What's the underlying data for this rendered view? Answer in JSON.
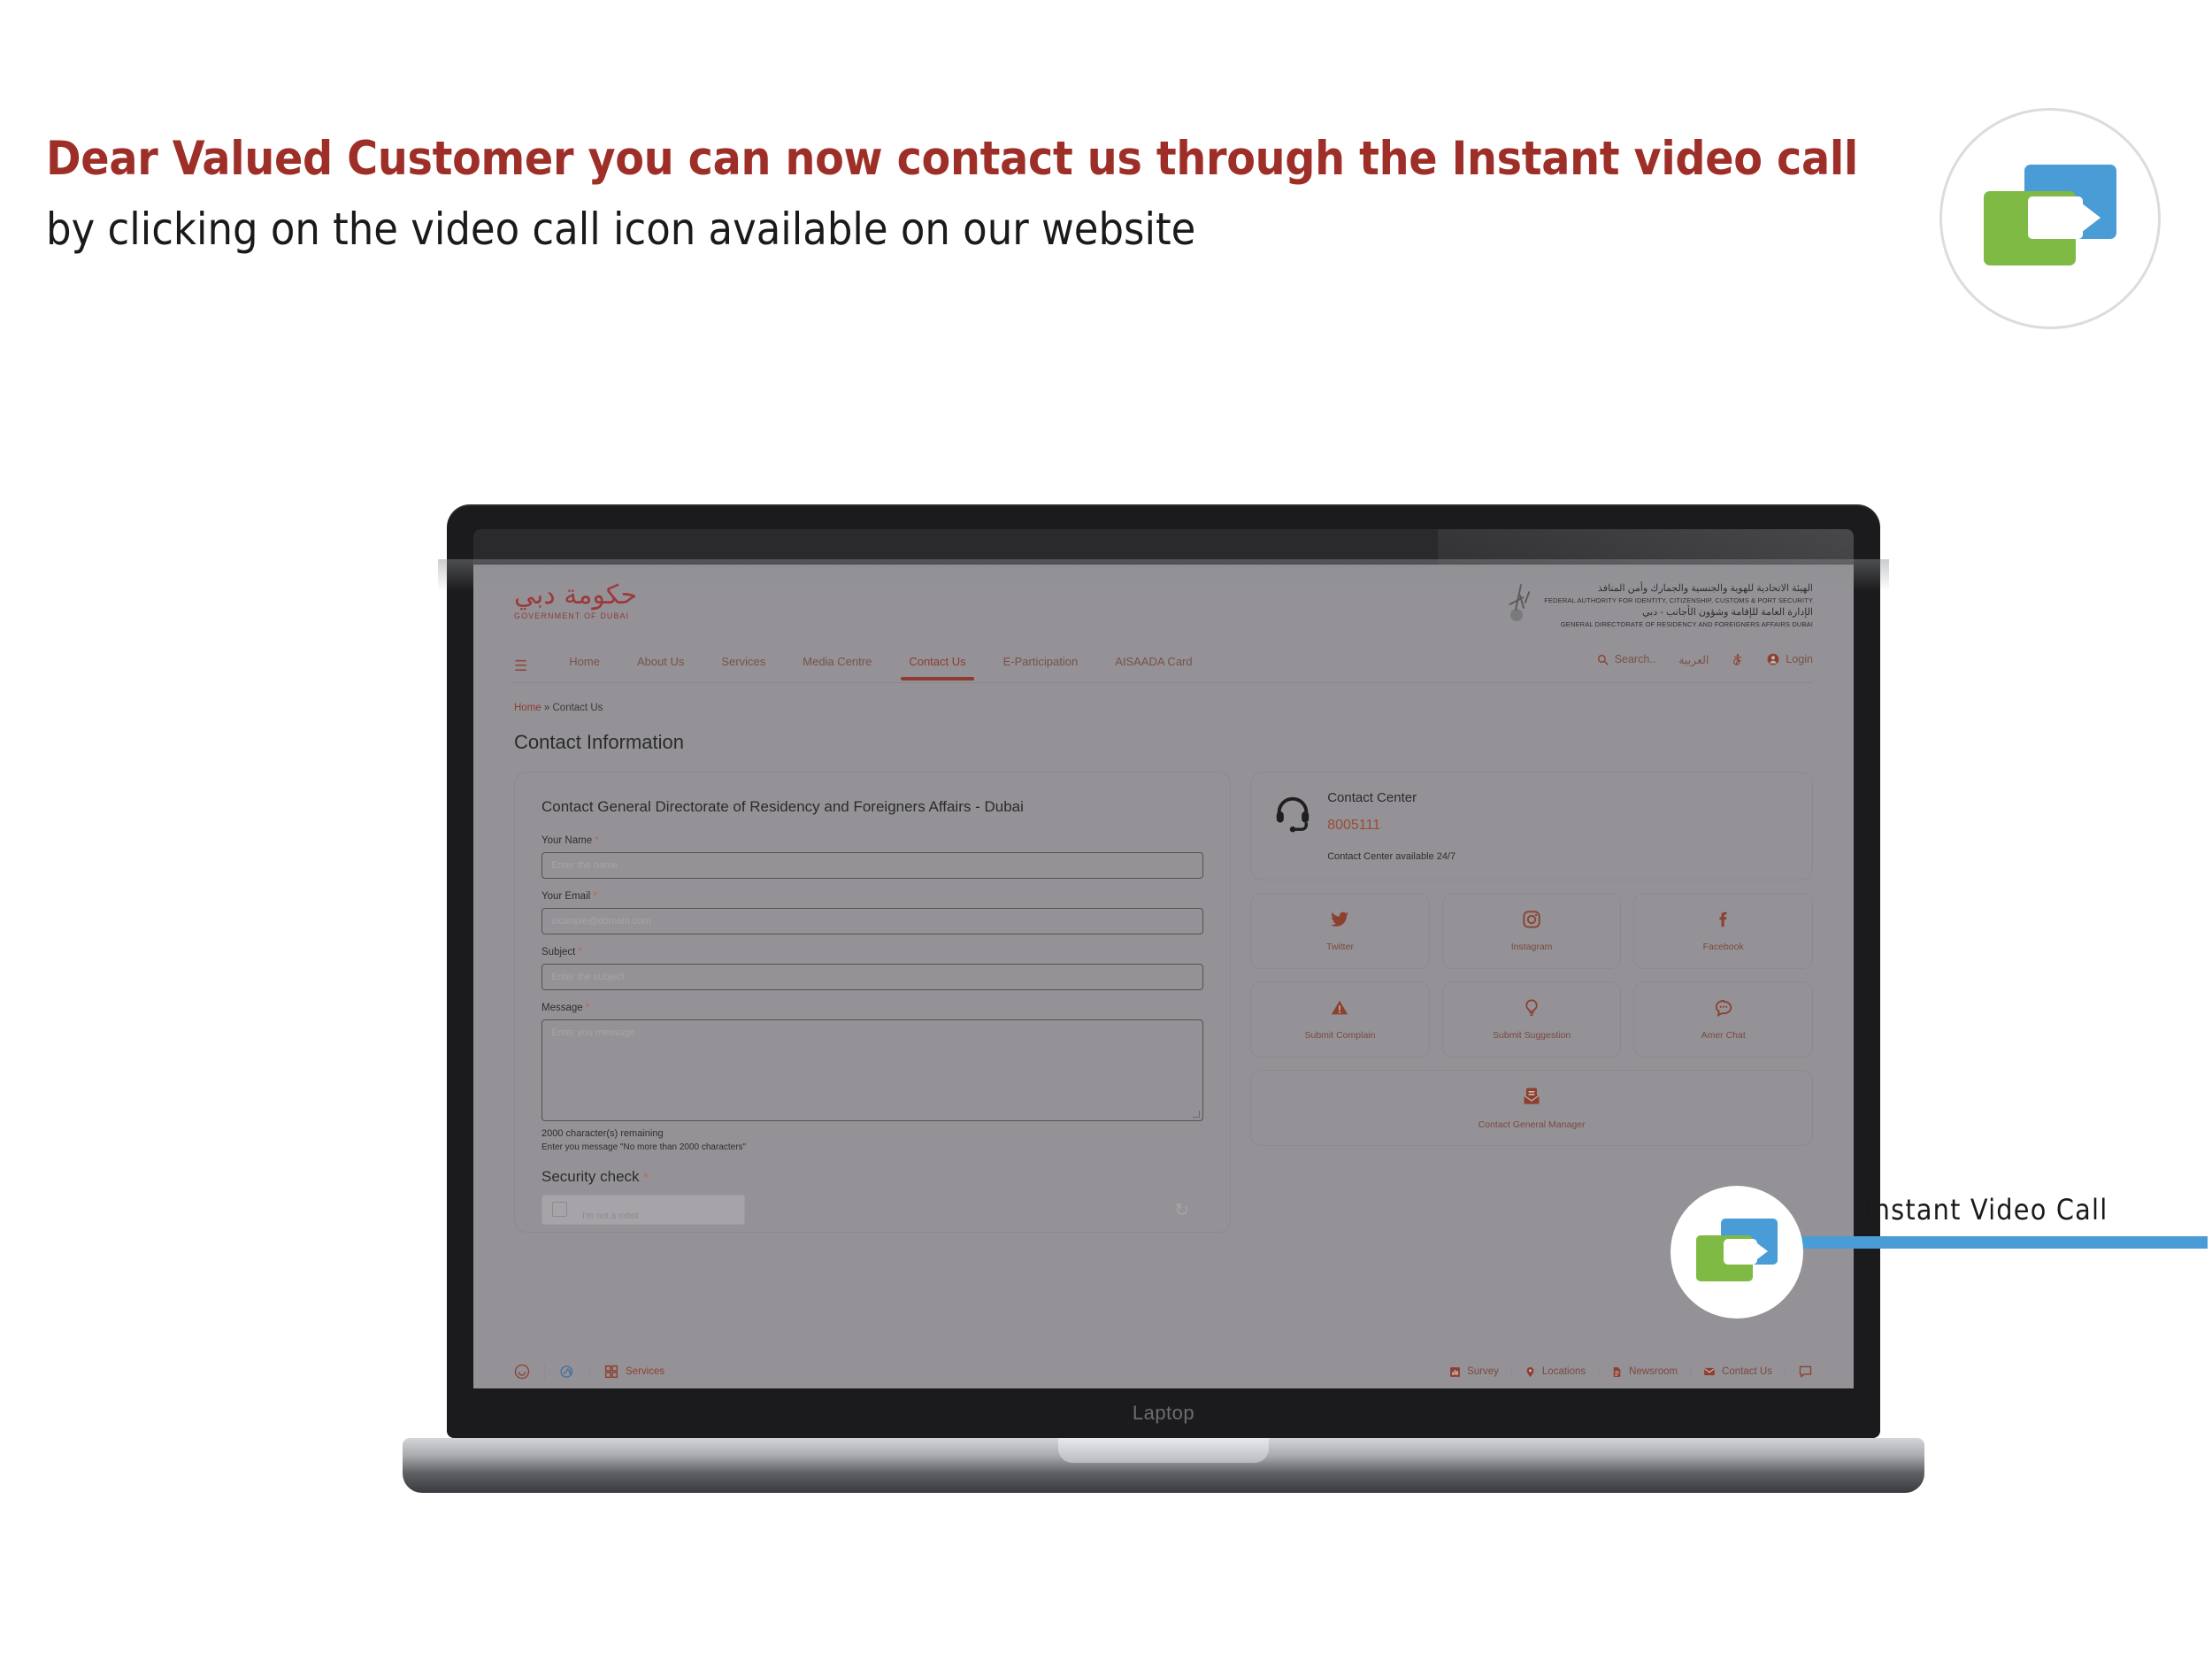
{
  "headline": {
    "line1": "Dear Valued Customer you can now contact us through the Instant video call",
    "line2": "by clicking on the video call icon available on our website",
    "line1_color": "#9e2f28",
    "line2_color": "#1a1a1a"
  },
  "badge": {
    "icon": "video-chat-icon"
  },
  "callout": {
    "label": "Instant Video Call",
    "line_color": "#4a9cd6",
    "icon": "video-chat-icon"
  },
  "device": {
    "label": "Laptop"
  },
  "site": {
    "gov_logo": {
      "arabic": "حكومة دبي",
      "latin": "GOVERNMENT OF DUBAI"
    },
    "federal_logo": {
      "ar_line1": "الهيئة الاتحادية للهوية والجنسية والجمارك وأمن المنافذ",
      "en_line1": "FEDERAL AUTHORITY FOR IDENTITY, CITIZENSHIP, CUSTOMS & PORT SECURITY",
      "ar_line2": "الإدارة العامة للإقامة وشؤون الأجانب - دبي",
      "en_line2": "GENERAL DIRECTORATE OF RESIDENCY AND FOREIGNERS AFFAIRS  DUBAI"
    },
    "nav": {
      "menu_icon": "hamburger-icon",
      "items": [
        {
          "label": "Home",
          "active": false
        },
        {
          "label": "About Us",
          "active": false
        },
        {
          "label": "Services",
          "active": false
        },
        {
          "label": "Media Centre",
          "active": false
        },
        {
          "label": "Contact Us",
          "active": true
        },
        {
          "label": "E-Participation",
          "active": false
        },
        {
          "label": "AISAADA Card",
          "active": false
        }
      ],
      "search_label": "Search..",
      "search_icon": "search-icon",
      "arabic_label": "العربية",
      "accessibility_icon": "accessibility-icon",
      "login_label": "Login",
      "login_icon": "user-circle-icon"
    },
    "breadcrumb": {
      "home": "Home",
      "separator": "»",
      "current": "Contact Us"
    },
    "page_title": "Contact Information",
    "form": {
      "title": "Contact General Directorate of Residency and Foreigners Affairs - Dubai",
      "required_mark": "*",
      "fields": [
        {
          "label": "Your Name",
          "placeholder": "Enter the name",
          "type": "text"
        },
        {
          "label": "Your Email",
          "placeholder": "example@domain.com",
          "type": "text"
        },
        {
          "label": "Subject",
          "placeholder": "Enter the subject",
          "type": "text"
        },
        {
          "label": "Message",
          "placeholder": "Enter you message",
          "type": "textarea"
        }
      ],
      "remaining_text": "2000 character(s) remaining",
      "message_hint": "Enter you message \"No more than 2000 characters\"",
      "security_check_label": "Security check",
      "captcha_text": "I'm not a robot"
    },
    "contact_center": {
      "icon": "headset-icon",
      "title": "Contact Center",
      "phone": "8005111",
      "availability": "Contact Center available 24/7",
      "phone_color": "#9b4b38"
    },
    "tiles": [
      {
        "label": "Twitter",
        "icon": "twitter-icon"
      },
      {
        "label": "Instagram",
        "icon": "instagram-icon"
      },
      {
        "label": "Facebook",
        "icon": "facebook-icon"
      },
      {
        "label": "Submit Complain",
        "icon": "warning-triangle-icon"
      },
      {
        "label": "Submit Suggestion",
        "icon": "lightbulb-icon"
      },
      {
        "label": "Amer Chat",
        "icon": "chat-bubble-dots-icon"
      },
      {
        "label": "Contact General Manager",
        "icon": "envelope-document-icon"
      }
    ],
    "footer_left": [
      {
        "label": "",
        "icon": "smiley-icon"
      },
      {
        "label": "",
        "icon": "sign-language-icon"
      },
      {
        "label": "Services",
        "icon": "grid-icon"
      }
    ],
    "footer_right": [
      {
        "label": "Survey",
        "icon": "bar-chart-icon"
      },
      {
        "label": "Locations",
        "icon": "map-pin-icon"
      },
      {
        "label": "Newsroom",
        "icon": "document-icon"
      },
      {
        "label": "Contact Us",
        "icon": "mail-icon"
      },
      {
        "label": "",
        "icon": "chat-icon"
      }
    ]
  }
}
